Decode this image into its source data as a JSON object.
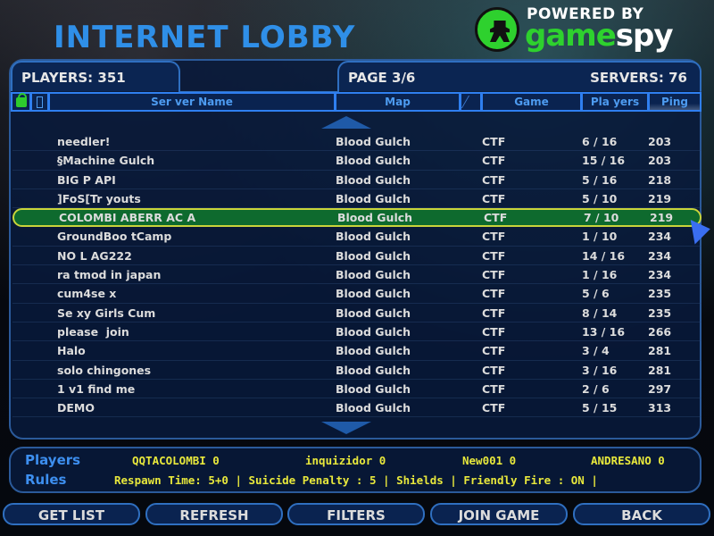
{
  "header": {
    "title": "INTERNET LOBBY",
    "logo_powered": "POWERED BY",
    "logo_game": "game",
    "logo_spy": "spy"
  },
  "status": {
    "players": "PLAYERS: 351",
    "page": "PAGE 3/6",
    "servers": "SERVERS: 76"
  },
  "columns": {
    "lock_icon": "lock-icon",
    "dedicated_icon": "phone-icon",
    "server_name": "Ser ver Name",
    "map": "Map",
    "mod_icon": "slash-icon",
    "game": "Game",
    "players": "Pla yers",
    "ping": "Ping"
  },
  "servers": [
    {
      "name": "needler!",
      "map": "Blood Gulch",
      "game": "CTF",
      "players": "6 / 16",
      "ping": "203"
    },
    {
      "name": "§Machine Gulch",
      "map": "Blood Gulch",
      "game": "CTF",
      "players": "15 / 16",
      "ping": "203"
    },
    {
      "name": "BIG P API",
      "map": "Blood Gulch",
      "game": "CTF",
      "players": "5 / 16",
      "ping": "218"
    },
    {
      "name": "]FoS[Tr youts",
      "map": "Blood Gulch",
      "game": "CTF",
      "players": "5 / 10",
      "ping": "219"
    },
    {
      "name": "COLOMBI ABERR AC A",
      "map": "Blood Gulch",
      "game": "CTF",
      "players": "7 / 10",
      "ping": "219",
      "selected": true
    },
    {
      "name": "GroundBoo tCamp",
      "map": "Blood Gulch",
      "game": "CTF",
      "players": "1 / 10",
      "ping": "234"
    },
    {
      "name": "NO L AG222",
      "map": "Blood Gulch",
      "game": "CTF",
      "players": "14 / 16",
      "ping": "234"
    },
    {
      "name": "ra tmod in japan",
      "map": "Blood Gulch",
      "game": "CTF",
      "players": "1 / 16",
      "ping": "234"
    },
    {
      "name": "cum4se x",
      "map": "Blood Gulch",
      "game": "CTF",
      "players": "5 / 6",
      "ping": "235"
    },
    {
      "name": "Se xy Girls Cum",
      "map": "Blood Gulch",
      "game": "CTF",
      "players": "8 / 14",
      "ping": "235"
    },
    {
      "name": "please  join",
      "map": "Blood Gulch",
      "game": "CTF",
      "players": "13 / 16",
      "ping": "266"
    },
    {
      "name": "Halo",
      "map": "Blood Gulch",
      "game": "CTF",
      "players": "3 / 4",
      "ping": "281"
    },
    {
      "name": "solo chingones",
      "map": "Blood Gulch",
      "game": "CTF",
      "players": "3 / 16",
      "ping": "281"
    },
    {
      "name": "1 v1 find me",
      "map": "Blood Gulch",
      "game": "CTF",
      "players": "2 / 6",
      "ping": "297"
    },
    {
      "name": "DEMO",
      "map": "Blood Gulch",
      "game": "CTF",
      "players": "5 / 15",
      "ping": "313"
    }
  ],
  "info": {
    "players_label": "Players",
    "rules_label": "Rules",
    "players": [
      "QQTACOLOMBI 0",
      "inquizidor 0",
      "New001 0",
      "ANDRESANO 0"
    ],
    "rules": "Respawn Time: 5+0 | Suicide Penalty : 5 | Shields | Friendly Fire : ON |"
  },
  "buttons": {
    "get_list": "GET LIST",
    "refresh": "REFRESH",
    "filters": "FILTERS",
    "join_game": "JOIN GAME",
    "back": "BACK"
  }
}
